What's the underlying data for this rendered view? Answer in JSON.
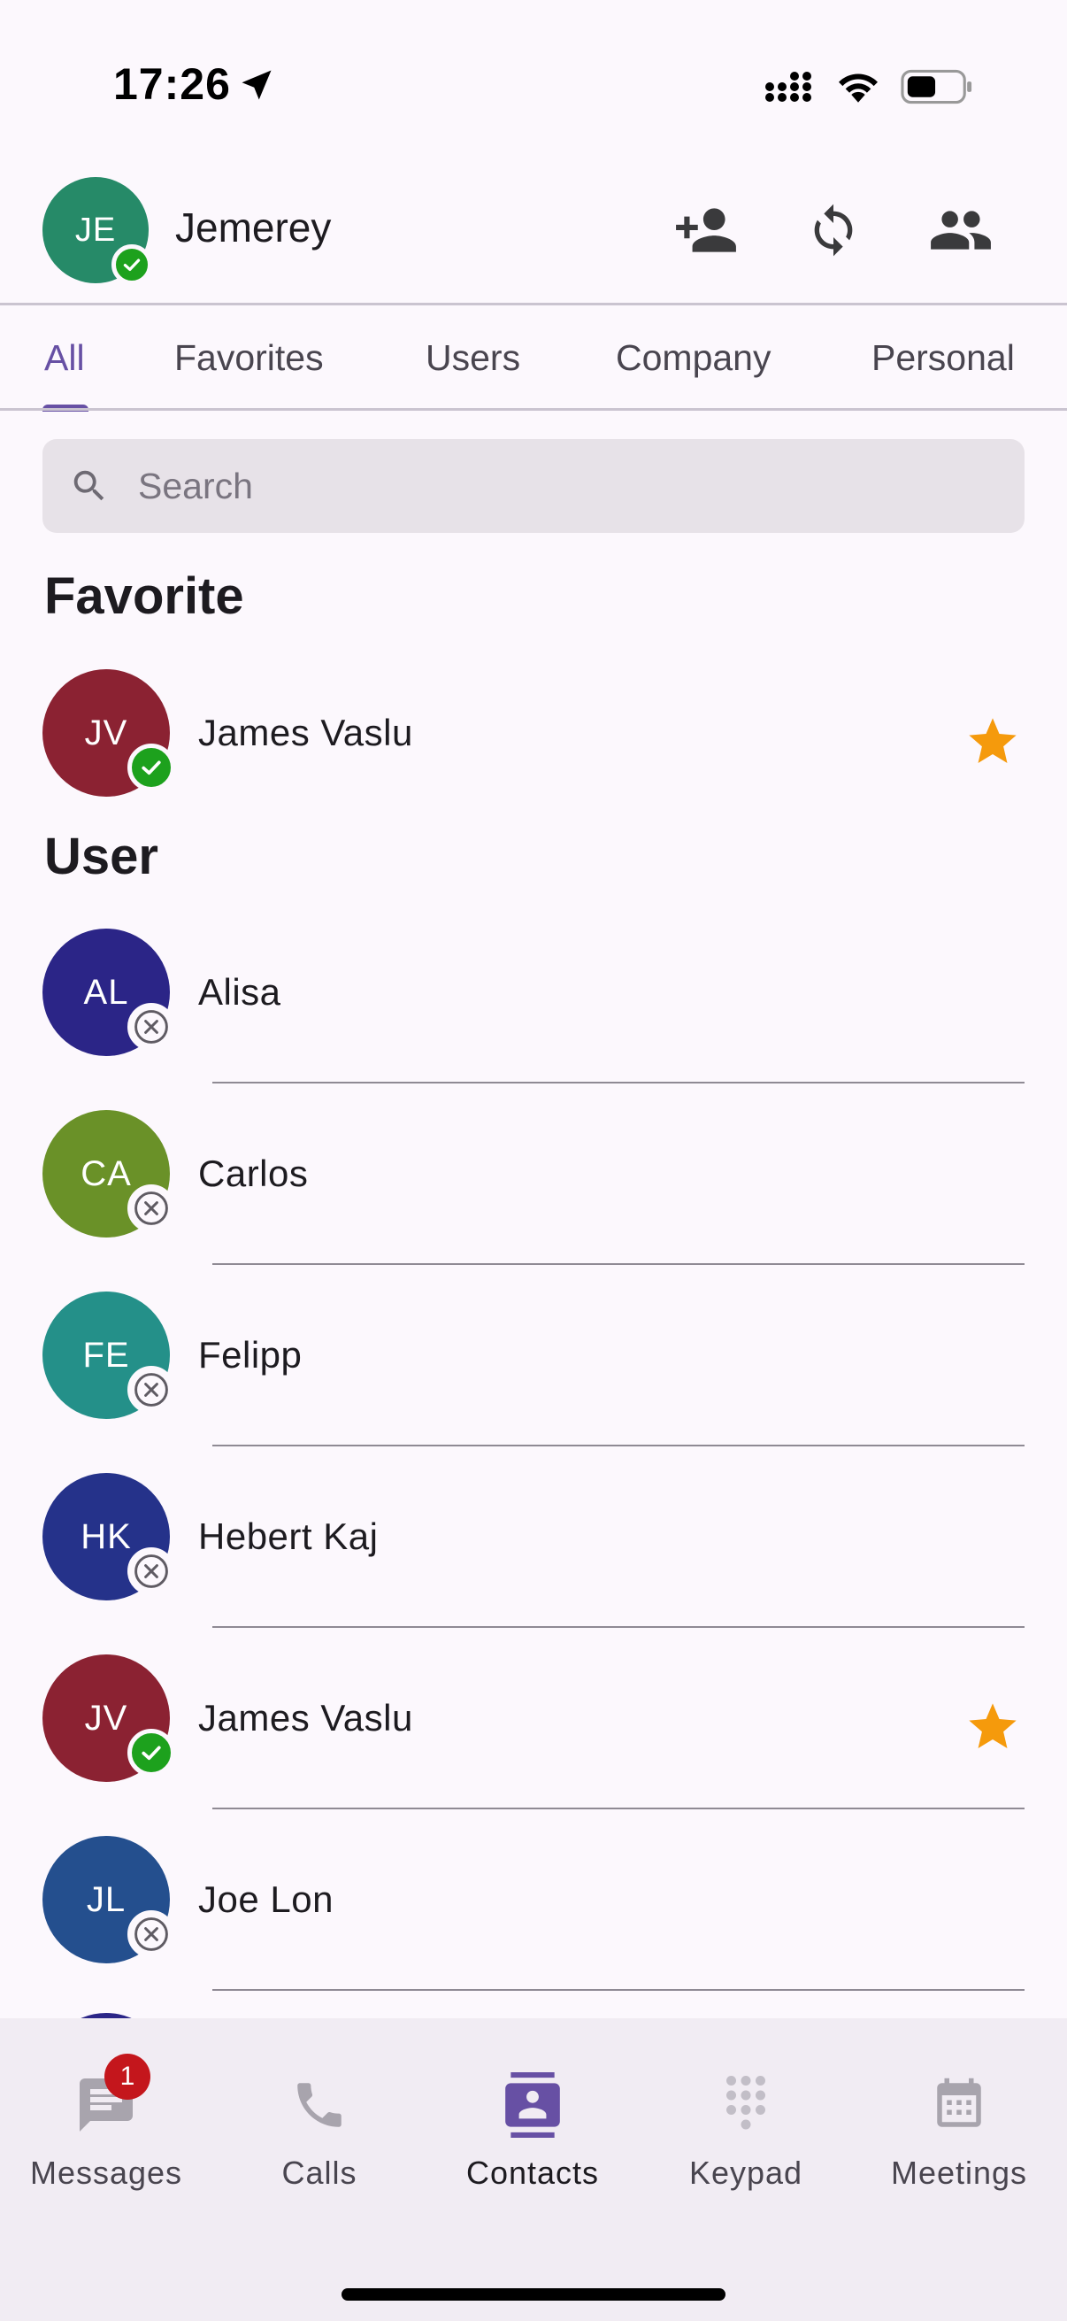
{
  "status_bar": {
    "time": "17:26"
  },
  "header": {
    "user_initials": "JE",
    "user_name": "Jemerey",
    "avatar_color": "#268a68",
    "presence": "online"
  },
  "tabs": [
    {
      "label": "All",
      "active": true
    },
    {
      "label": "Favorites",
      "active": false
    },
    {
      "label": "Users",
      "active": false
    },
    {
      "label": "Company",
      "active": false
    },
    {
      "label": "Personal",
      "active": false
    }
  ],
  "search": {
    "placeholder": "Search",
    "value": ""
  },
  "sections": {
    "favorite": {
      "title": "Favorite",
      "contacts": [
        {
          "initials": "JV",
          "name": "James Vaslu",
          "color": "#8b2232",
          "presence": "online",
          "favorite": true
        }
      ]
    },
    "user": {
      "title": "User",
      "contacts": [
        {
          "initials": "AL",
          "name": "Alisa",
          "color": "#2b2587",
          "presence": "offline",
          "favorite": false
        },
        {
          "initials": "CA",
          "name": "Carlos",
          "color": "#6a9128",
          "presence": "offline",
          "favorite": false
        },
        {
          "initials": "FE",
          "name": "Felipp",
          "color": "#249089",
          "presence": "offline",
          "favorite": false
        },
        {
          "initials": "HK",
          "name": "Hebert Kaj",
          "color": "#25328a",
          "presence": "offline",
          "favorite": false
        },
        {
          "initials": "JV",
          "name": "James Vaslu",
          "color": "#8b2232",
          "presence": "online",
          "favorite": true
        },
        {
          "initials": "JL",
          "name": "Joe Lon",
          "color": "#244f8e",
          "presence": "offline",
          "favorite": false
        }
      ]
    }
  },
  "bottom_nav": [
    {
      "label": "Messages",
      "icon": "message-icon",
      "badge": "1",
      "active": false
    },
    {
      "label": "Calls",
      "icon": "phone-icon",
      "badge": "",
      "active": false
    },
    {
      "label": "Contacts",
      "icon": "contacts-icon",
      "badge": "",
      "active": true
    },
    {
      "label": "Keypad",
      "icon": "keypad-icon",
      "badge": "",
      "active": false
    },
    {
      "label": "Meetings",
      "icon": "calendar-icon",
      "badge": "",
      "active": false
    }
  ],
  "colors": {
    "accent": "#6750a4",
    "online": "#1da11d",
    "star": "#f59a0c",
    "badge": "#c4161c"
  }
}
